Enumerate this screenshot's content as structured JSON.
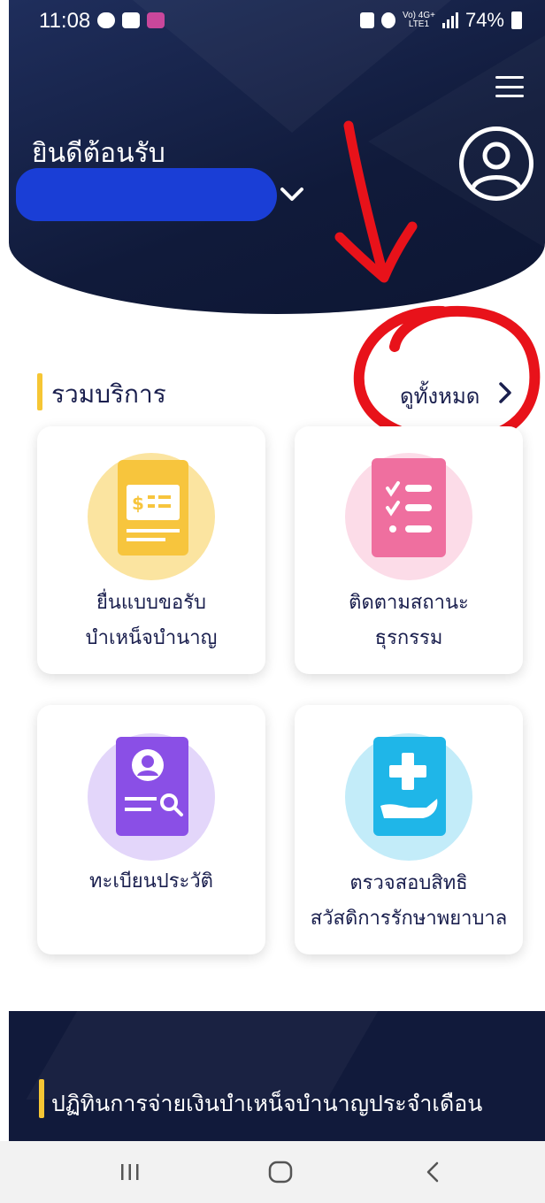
{
  "status_bar": {
    "time": "11:08",
    "network_type_top": "Vo) 4G+",
    "network_type_bottom": "LTE1",
    "battery": "74%"
  },
  "header": {
    "welcome": "ยินดีต้อนรับ",
    "user_name": ""
  },
  "services": {
    "title": "รวมบริการ",
    "see_all": "ดูทั้งหมด",
    "items": [
      {
        "line1": "ยื่นแบบขอรับ",
        "line2": "บำเหน็จบำนาญ",
        "icon": "document-money-icon",
        "color": "#f7c53d",
        "bg": "#fbe4a0"
      },
      {
        "line1": "ติดตามสถานะ",
        "line2": "ธุรกรรม",
        "icon": "checklist-icon",
        "color": "#ef6f9f",
        "bg": "#fcdce8"
      },
      {
        "line1": "ทะเบียนประวัติ",
        "line2": "",
        "icon": "profile-search-icon",
        "color": "#8a4fe6",
        "bg": "#e3d6fa"
      },
      {
        "line1": "ตรวจสอบสิทธิ",
        "line2": "สวัสดิการรักษาพยาบาล",
        "icon": "medical-hand-icon",
        "color": "#1fb6e8",
        "bg": "#c3ecf9"
      }
    ]
  },
  "bottom_section": {
    "title": "ปฏิทินการจ่ายเงินบำเหน็จบำนาญประจำเดือน"
  },
  "colors": {
    "header_bg": "#101a3a",
    "accent_yellow": "#f6c634",
    "text_dark": "#1a1f4e",
    "annotation_red": "#e8121a"
  }
}
